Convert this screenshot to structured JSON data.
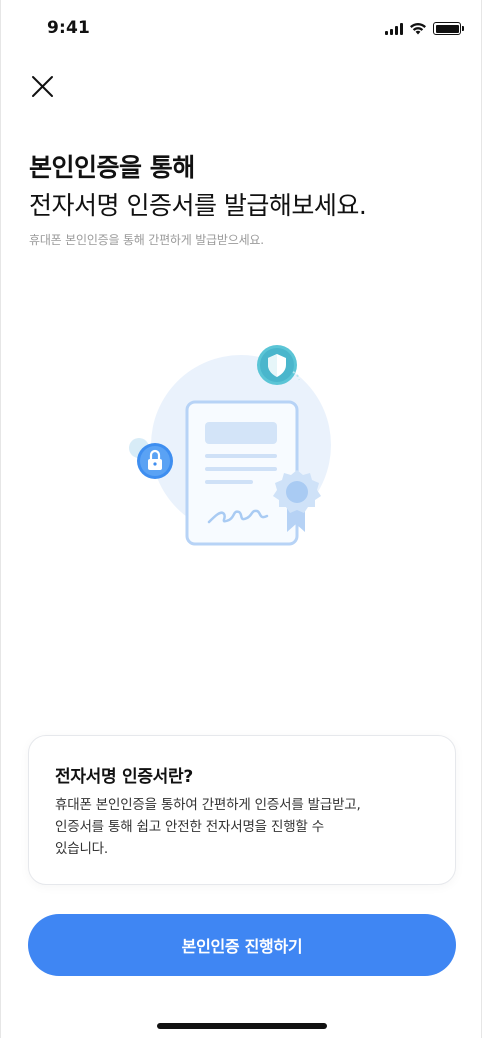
{
  "status_bar": {
    "time": "9:41"
  },
  "header": {
    "title_bold": "본인인증을 통해",
    "title_light": "전자서명 인증서를 발급해보세요.",
    "subtitle": "휴대폰 본인인증을 통해 간편하게 발급받으세요."
  },
  "illustration": {
    "signature_text": "ilu"
  },
  "info_card": {
    "title": "전자서명 인증서란?",
    "body_line1": "휴대폰 본인인증을 통하여 간편하게 인증서를 발급받고,",
    "body_line2": "인증서를 통해 쉽고 안전한 전자서명을 진행할 수",
    "body_line3": "있습니다."
  },
  "cta": {
    "label": "본인인증 진행하기"
  },
  "colors": {
    "primary": "#3f86f3",
    "illustration_light": "#e8f1fc",
    "teal": "#5bc5d6"
  }
}
